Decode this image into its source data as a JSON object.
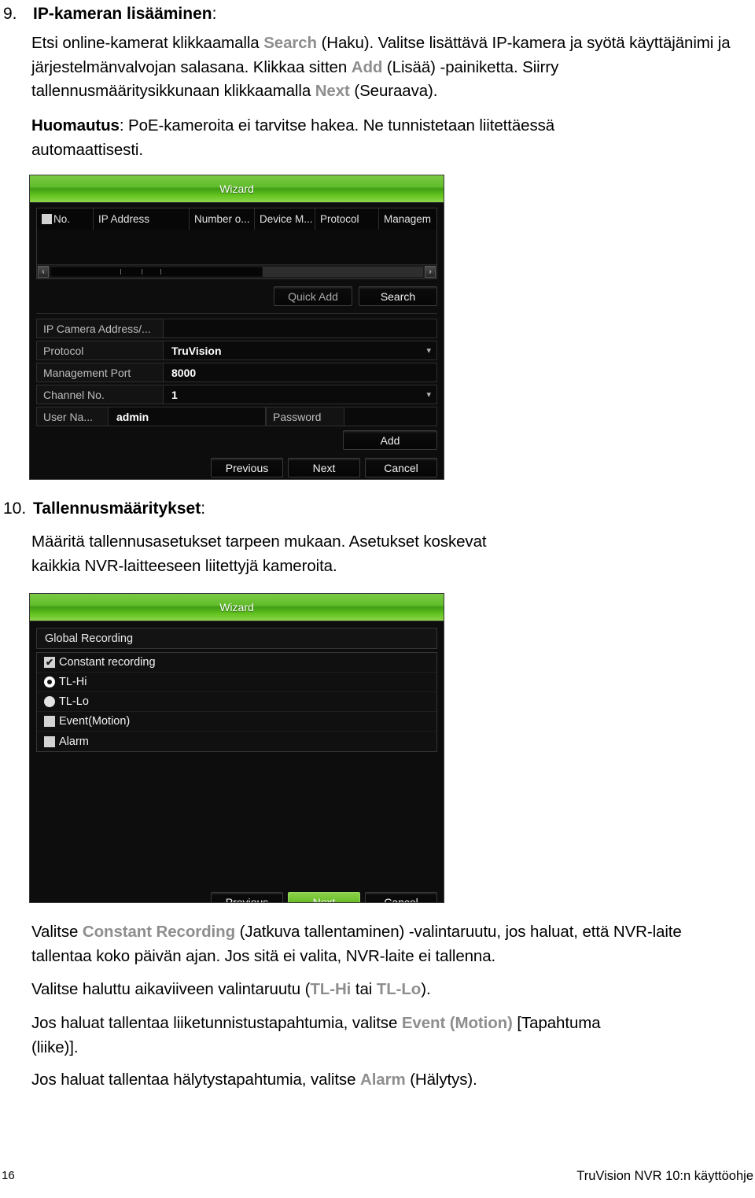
{
  "document": {
    "footer": {
      "page_number": "16",
      "doc_title": "TruVision NVR 10:n käyttöohje"
    }
  },
  "section9": {
    "number": "9.",
    "heading": "IP-kameran lisääminen",
    "heading_suffix": ":",
    "paragraph1": {
      "t1": "Etsi online-kamerat klikkaamalla ",
      "ui1": "Search",
      "t2": " (Haku). Valitse lisättävä IP-kamera ja syötä käyttäjänimi ja järjestelmänvalvojan salasana. Klikkaa sitten ",
      "ui2": "Add",
      "t3": " (Lisää) -painiketta. Siirry tallennusmääritysikkunaan klikkaamalla ",
      "ui3": "Next",
      "t4": " (Seuraava)."
    },
    "paragraph2": {
      "bold": "Huomautus",
      "text": ": PoE-kameroita ei tarvitse hakea. Ne tunnistetaan liitettäessä automaattisesti."
    }
  },
  "wizard_ip_camera": {
    "title": "Wizard",
    "table": {
      "headers": [
        "No.",
        "IP Address",
        "Number o...",
        "Device M...",
        "Protocol",
        "Managem"
      ],
      "rows": []
    },
    "scrollbar": {
      "left_arrow": "‹",
      "right_arrow": "›"
    },
    "table_buttons": [
      {
        "label": "Quick Add",
        "style": "dim"
      },
      {
        "label": "Search",
        "style": "normal"
      }
    ],
    "form": [
      {
        "label": "IP Camera Address/...",
        "value": "",
        "type": "text"
      },
      {
        "label": "Protocol",
        "value": "TruVision",
        "type": "select"
      },
      {
        "label": "Management Port",
        "value": "8000",
        "type": "text"
      },
      {
        "label": "Channel No.",
        "value": "1",
        "type": "select"
      }
    ],
    "user_row": {
      "user_label": "User Na...",
      "user_value": "admin",
      "password_label": "Password",
      "password_value": ""
    },
    "add_button": "Add",
    "footer_buttons": [
      {
        "label": "Previous",
        "active": false
      },
      {
        "label": "Next",
        "active": false
      },
      {
        "label": "Cancel",
        "active": false
      }
    ]
  },
  "section10": {
    "number": "10.",
    "heading": "Tallennusmääritykset",
    "heading_suffix": ":",
    "paragraph1": "Määritä tallennusasetukset tarpeen mukaan. Asetukset koskevat kaikkia NVR-laitteeseen liitettyjä kameroita."
  },
  "wizard_recording": {
    "title": "Wizard",
    "group_label": "Global Recording",
    "options": [
      {
        "label": "Constant recording",
        "indicator": "checkbox-checked",
        "check_glyph": "✔"
      },
      {
        "label": "TL-Hi",
        "indicator": "radio-selected"
      },
      {
        "label": "TL-Lo",
        "indicator": "radio-unselected"
      },
      {
        "label": "Event(Motion)",
        "indicator": "checkbox-unchecked"
      },
      {
        "label": "Alarm",
        "indicator": "checkbox-unchecked"
      }
    ],
    "footer_buttons": [
      {
        "label": "Previous",
        "active": false
      },
      {
        "label": "Next",
        "active": true
      },
      {
        "label": "Cancel",
        "active": false
      }
    ]
  },
  "section10_notes": {
    "para1": {
      "t1": "Valitse ",
      "ui1": "Constant Recording",
      "t2": " (Jatkuva tallentaminen) -valintaruutu, jos haluat, että NVR-laite tallentaa koko päivän ajan. Jos sitä ei valita, NVR-laite ei tallenna."
    },
    "para2": {
      "t1": "Valitse haluttu aikaviiveen valintaruutu (",
      "ui1": "TL-Hi",
      "t2": " tai ",
      "ui2": "TL-Lo",
      "t3": ")."
    },
    "para3": {
      "t1": "Jos haluat tallentaa liiketunnistustapahtumia, valitse ",
      "ui1": "Event (Motion)",
      "t2": " [Tapahtuma (liike)]."
    },
    "para4": {
      "t1": "Jos haluat tallentaa hälytystapahtumia, valitse ",
      "ui1": "Alarm",
      "t2": " (Hälytys)."
    }
  },
  "colors": {
    "accent_green": "#7ac943",
    "ui_term_gray": "#8e8e8e",
    "dialog_bg": "#0d0d0d"
  }
}
